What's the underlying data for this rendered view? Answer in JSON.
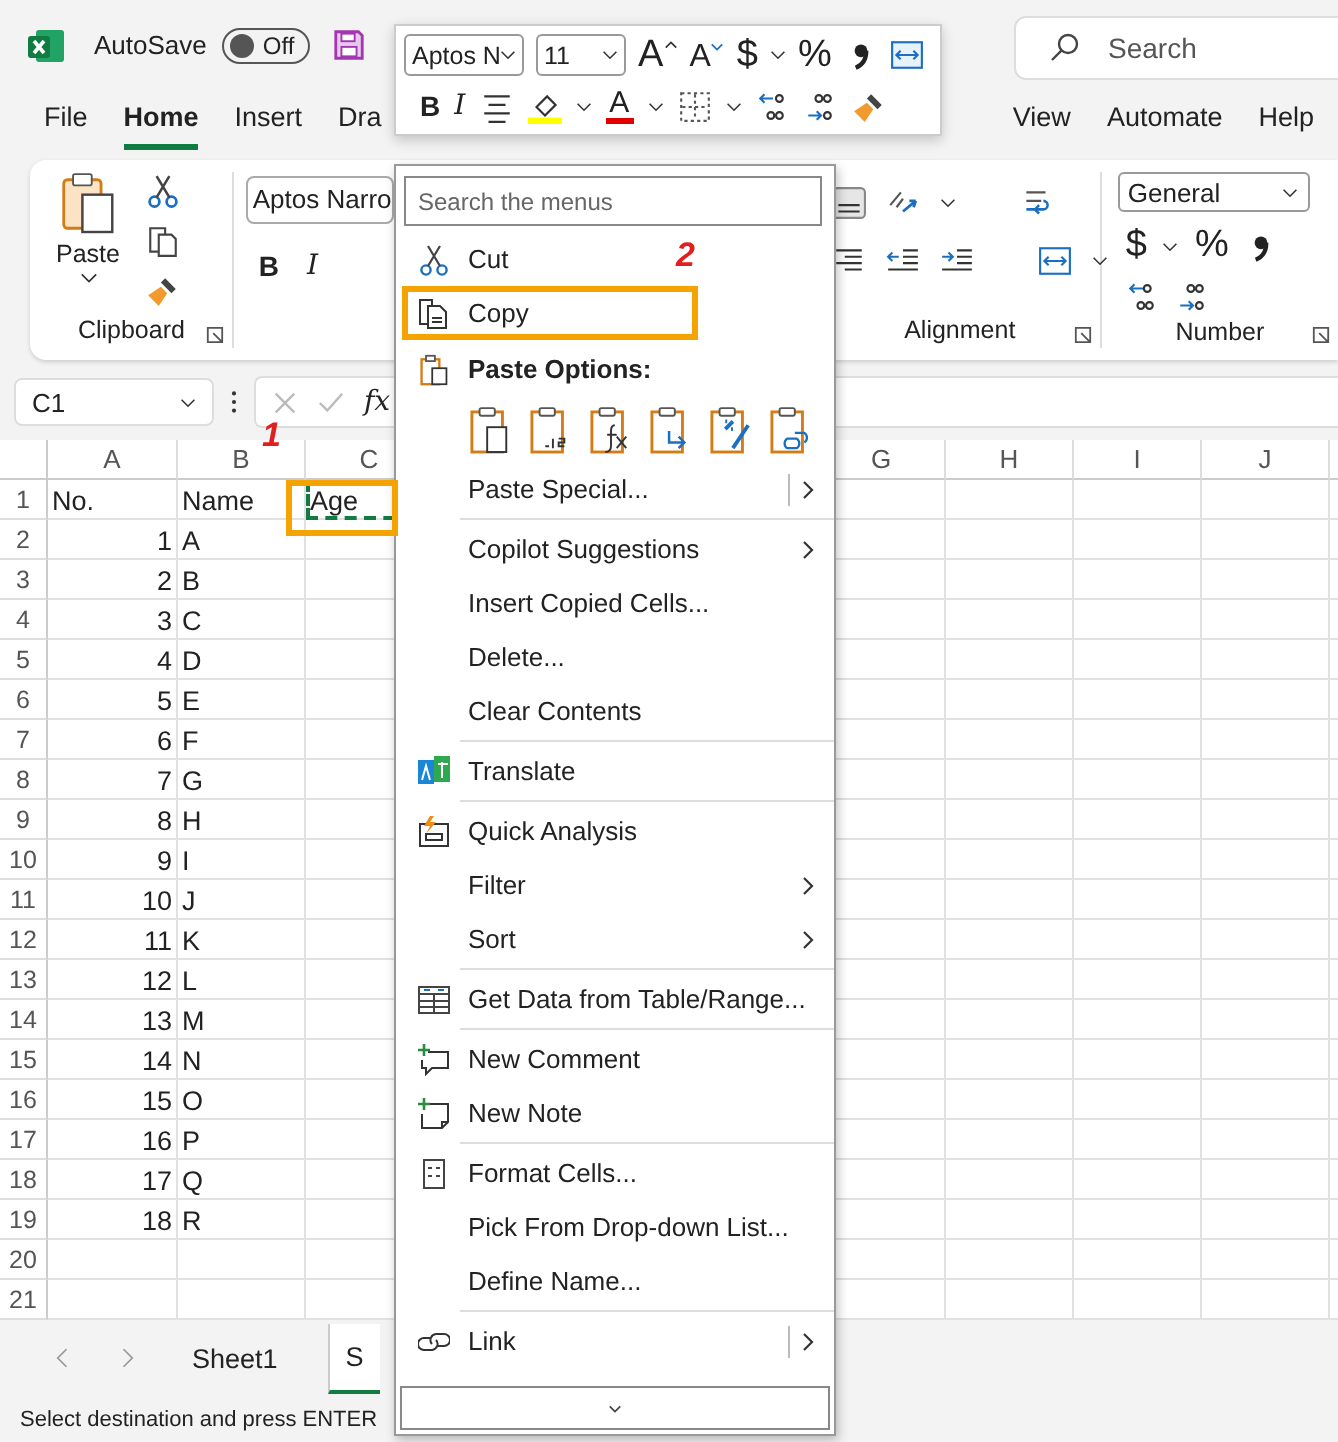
{
  "title_bar": {
    "autosave_label": "AutoSave",
    "autosave_toggle": {
      "label": "Off",
      "on": false
    },
    "search": {
      "placeholder": "Search"
    }
  },
  "ribbon_tabs": [
    {
      "label": "File",
      "selected": false
    },
    {
      "label": "Home",
      "selected": true
    },
    {
      "label": "Insert",
      "selected": false
    },
    {
      "label": "Dra",
      "selected": false
    },
    {
      "label": "View",
      "selected": false
    },
    {
      "label": "Automate",
      "selected": false
    },
    {
      "label": "Help",
      "selected": false
    }
  ],
  "ribbon": {
    "clipboard": {
      "paste_label": "Paste",
      "group_label": "Clipboard"
    },
    "font": {
      "font_name": "Aptos Narro",
      "bold": "B",
      "italic": "I"
    },
    "alignment": {
      "group_label": "Alignment"
    },
    "number": {
      "format": "General",
      "currency": "$",
      "percent": "%",
      "group_label": "Number"
    }
  },
  "formula_bar": {
    "name_box": "C1",
    "function_label": "fx"
  },
  "columns_left": [
    "A",
    "B",
    "C"
  ],
  "columns_right": [
    "G",
    "H",
    "I",
    "J"
  ],
  "sheet": {
    "copy_marquee": true,
    "c1_annotated": true
  },
  "rows": [
    {
      "number": "1",
      "a": "No.",
      "b": "Name",
      "c": "Age"
    },
    {
      "number": "2",
      "a": "1",
      "b": "A"
    },
    {
      "number": "3",
      "a": "2",
      "b": "B"
    },
    {
      "number": "4",
      "a": "3",
      "b": "C"
    },
    {
      "number": "5",
      "a": "4",
      "b": "D"
    },
    {
      "number": "6",
      "a": "5",
      "b": "E"
    },
    {
      "number": "7",
      "a": "6",
      "b": "F"
    },
    {
      "number": "8",
      "a": "7",
      "b": "G"
    },
    {
      "number": "9",
      "a": "8",
      "b": "H"
    },
    {
      "number": "10",
      "a": "9",
      "b": "I"
    },
    {
      "number": "11",
      "a": "10",
      "b": "J"
    },
    {
      "number": "12",
      "a": "11",
      "b": "K"
    },
    {
      "number": "13",
      "a": "12",
      "b": "L"
    },
    {
      "number": "14",
      "a": "13",
      "b": "M"
    },
    {
      "number": "15",
      "a": "14",
      "b": "N"
    },
    {
      "number": "16",
      "a": "15",
      "b": "O"
    },
    {
      "number": "17",
      "a": "16",
      "b": "P"
    },
    {
      "number": "18",
      "a": "17",
      "b": "Q"
    },
    {
      "number": "19",
      "a": "18",
      "b": "R"
    },
    {
      "number": "20"
    },
    {
      "number": "21"
    }
  ],
  "sheet_tabs": [
    {
      "label": "Sheet1",
      "selected": false
    },
    {
      "label": "S",
      "selected": true
    }
  ],
  "status_bar": "Select destination and press ENTER",
  "mini_toolbar": {
    "font": "Aptos N",
    "size": "11",
    "grow_font": "A",
    "shrink_font": "A",
    "currency": "$",
    "percent": "%",
    "bold": "B",
    "italic": "I",
    "font_color": "A"
  },
  "context_menu": {
    "search_placeholder": "Search the menus",
    "items": [
      {
        "kind": "item",
        "label": "Cut",
        "submenu": false,
        "split": false,
        "highlighted": false
      },
      {
        "kind": "item",
        "label": "Copy",
        "submenu": false,
        "split": false,
        "highlighted": true
      },
      {
        "kind": "header",
        "label": "Paste Options:"
      },
      {
        "kind": "paste_icons"
      },
      {
        "kind": "item",
        "label": "Paste Special...",
        "submenu": true,
        "split": true,
        "highlighted": false
      },
      {
        "kind": "separator"
      },
      {
        "kind": "item",
        "label": "Copilot Suggestions",
        "submenu": true,
        "split": false,
        "highlighted": false
      },
      {
        "kind": "item",
        "label": "Insert Copied Cells...",
        "submenu": false,
        "split": false,
        "highlighted": false
      },
      {
        "kind": "item",
        "label": "Delete...",
        "submenu": false,
        "split": false,
        "highlighted": false
      },
      {
        "kind": "item",
        "label": "Clear Contents",
        "submenu": false,
        "split": false,
        "highlighted": false
      },
      {
        "kind": "separator"
      },
      {
        "kind": "item",
        "label": "Translate",
        "submenu": false,
        "split": false,
        "highlighted": false
      },
      {
        "kind": "separator"
      },
      {
        "kind": "item",
        "label": "Quick Analysis",
        "submenu": false,
        "split": false,
        "highlighted": false
      },
      {
        "kind": "item",
        "label": "Filter",
        "submenu": true,
        "split": false,
        "highlighted": false
      },
      {
        "kind": "item",
        "label": "Sort",
        "submenu": true,
        "split": false,
        "highlighted": false
      },
      {
        "kind": "separator"
      },
      {
        "kind": "item",
        "label": "Get Data from Table/Range...",
        "submenu": false,
        "split": false,
        "highlighted": false
      },
      {
        "kind": "separator"
      },
      {
        "kind": "item",
        "label": "New Comment",
        "submenu": false,
        "split": false,
        "highlighted": false
      },
      {
        "kind": "item",
        "label": "New Note",
        "submenu": false,
        "split": false,
        "highlighted": false
      },
      {
        "kind": "separator"
      },
      {
        "kind": "item",
        "label": "Format Cells...",
        "submenu": false,
        "split": false,
        "highlighted": false
      },
      {
        "kind": "item",
        "label": "Pick From Drop-down List...",
        "submenu": false,
        "split": false,
        "highlighted": false
      },
      {
        "kind": "item",
        "label": "Define Name...",
        "submenu": false,
        "split": false,
        "highlighted": false
      },
      {
        "kind": "separator"
      },
      {
        "kind": "item",
        "label": "Link",
        "submenu": true,
        "split": true,
        "highlighted": false
      }
    ]
  },
  "annotations": [
    {
      "label": "1"
    },
    {
      "label": "2"
    }
  ]
}
